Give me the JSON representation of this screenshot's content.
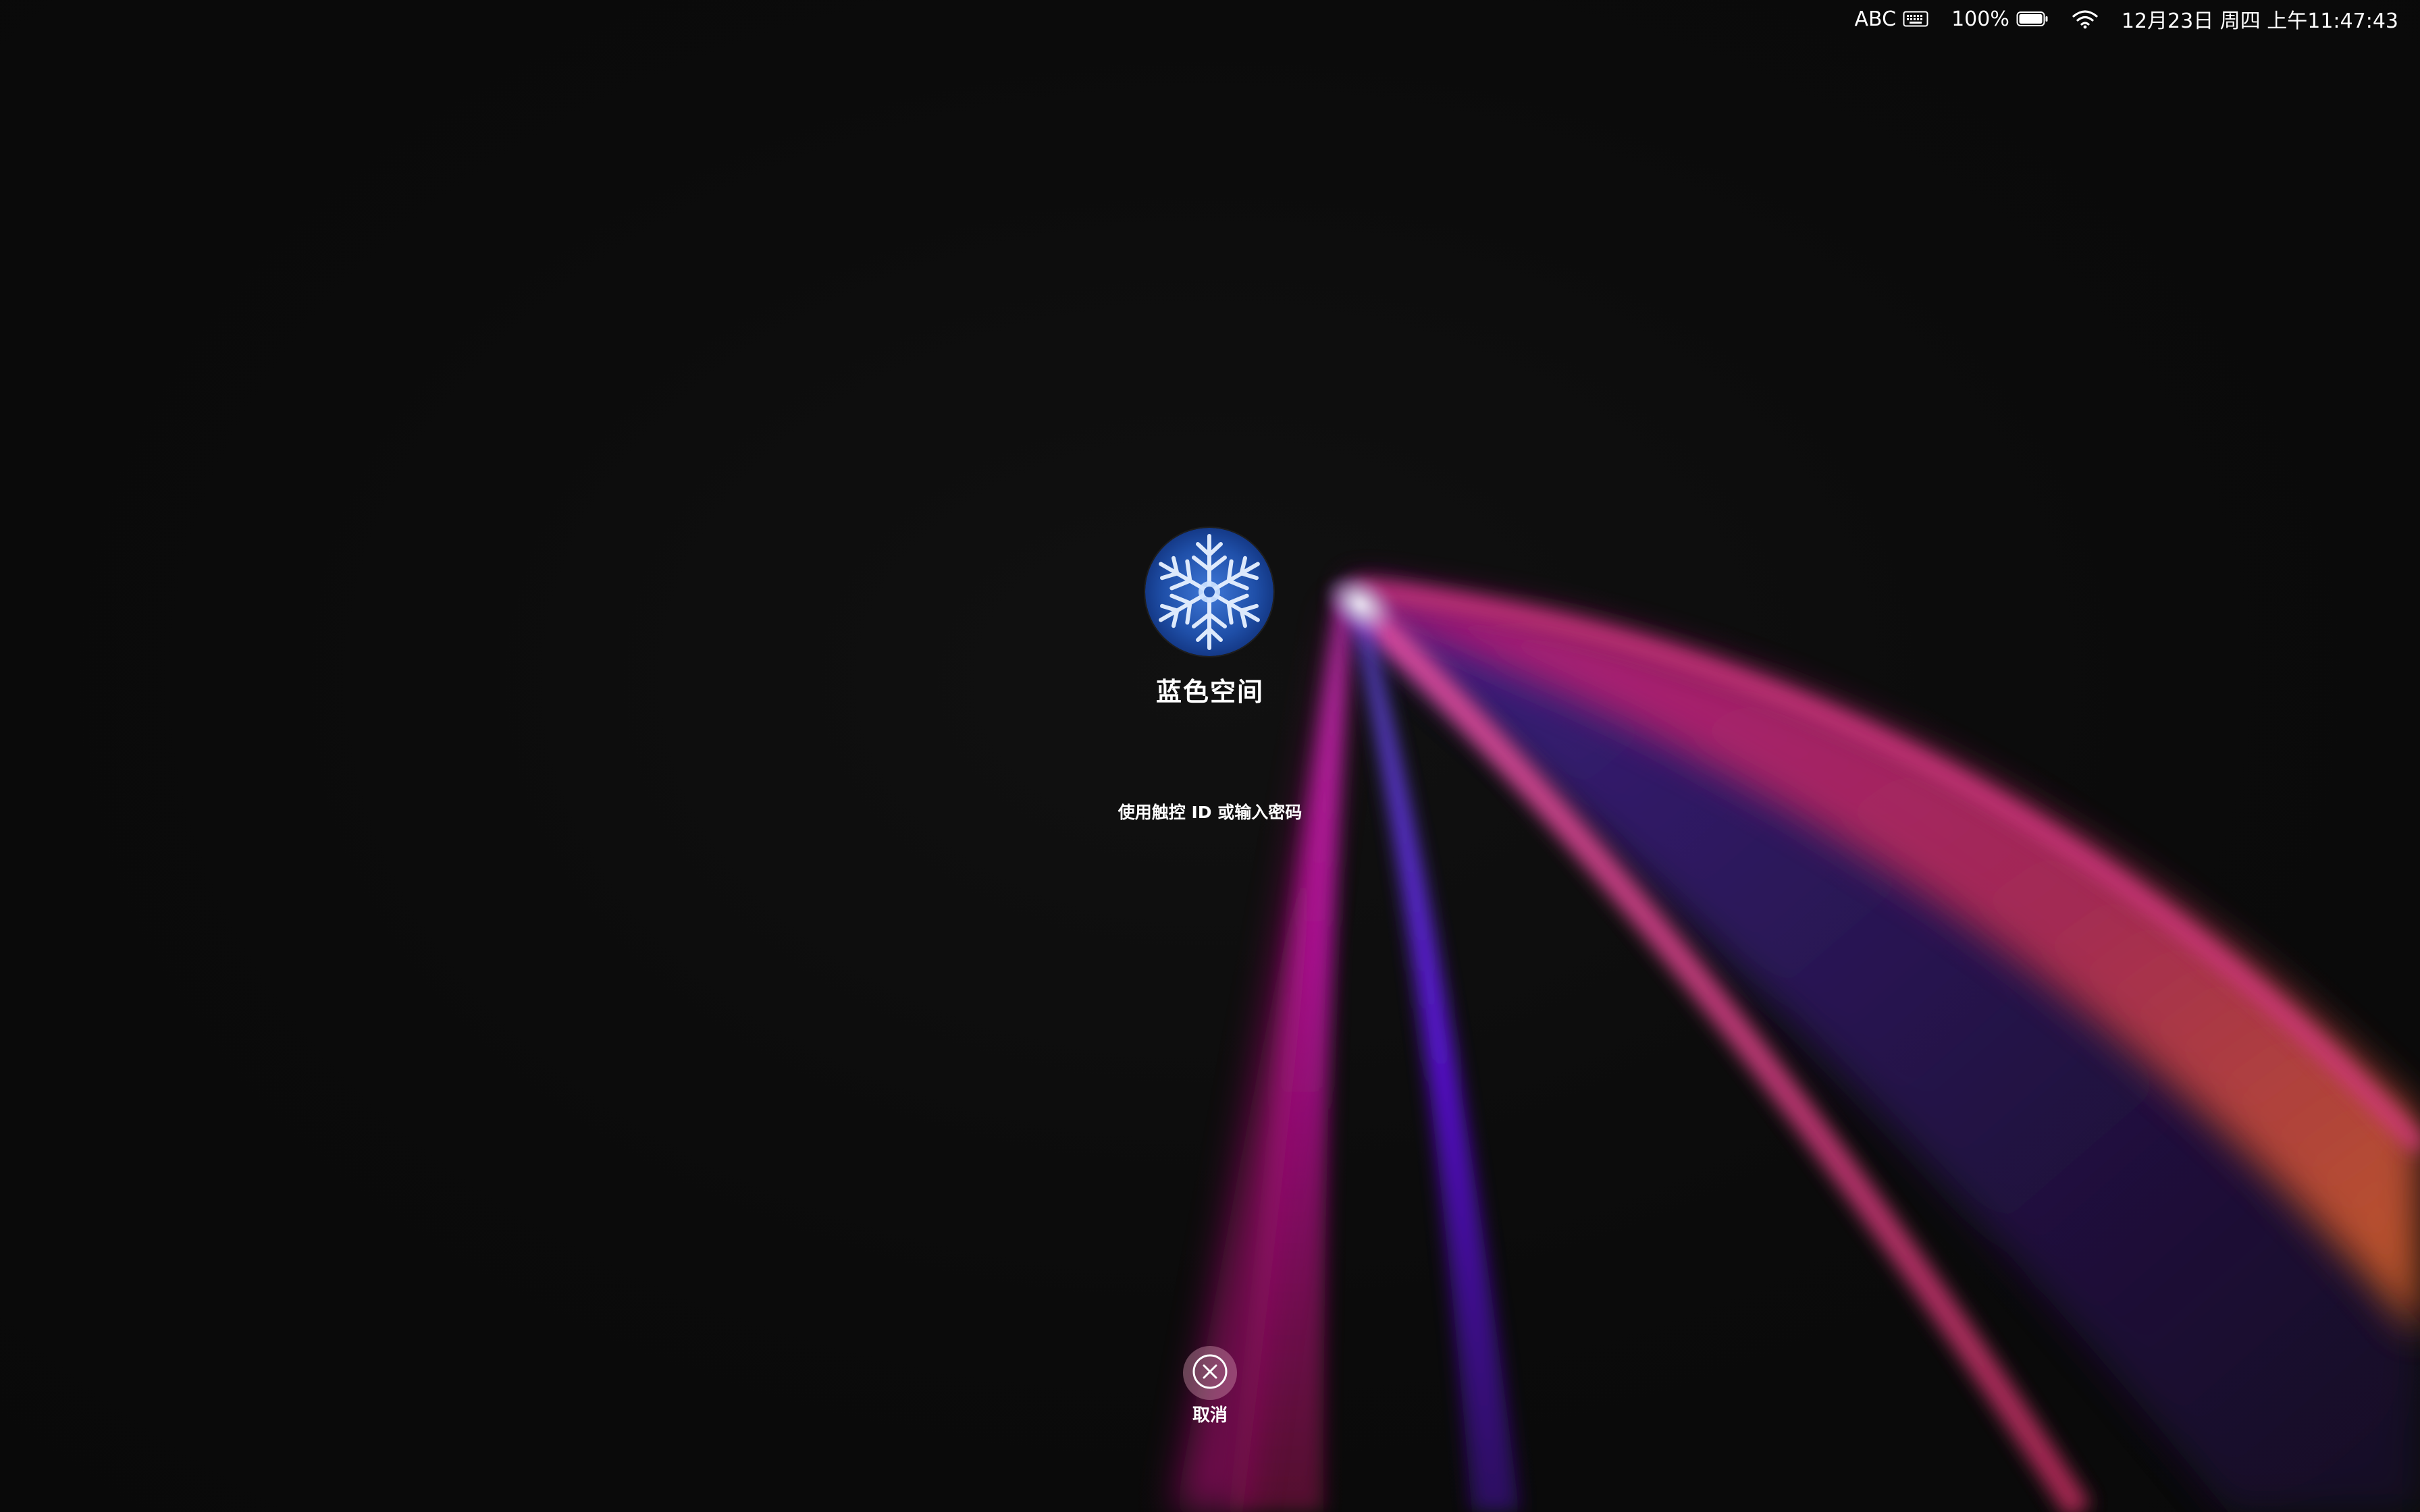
{
  "menubar": {
    "input_source": "ABC",
    "battery_percent": "100%",
    "datetime": "12月23日 周四 上午11:47:43",
    "icons": [
      "keyboard-icon",
      "battery-icon",
      "wifi-icon"
    ]
  },
  "login": {
    "user_name": "蓝色空间",
    "prompt": "使用触控 ID 或输入密码",
    "cancel_label": "取消",
    "avatar_icon": "snowflake-avatar-icon"
  },
  "colors": {
    "background": "#0b0b0b",
    "magenta": "#c01bb0",
    "pink": "#e0408a",
    "violet": "#5a19d8",
    "orange": "#d36a2c"
  }
}
